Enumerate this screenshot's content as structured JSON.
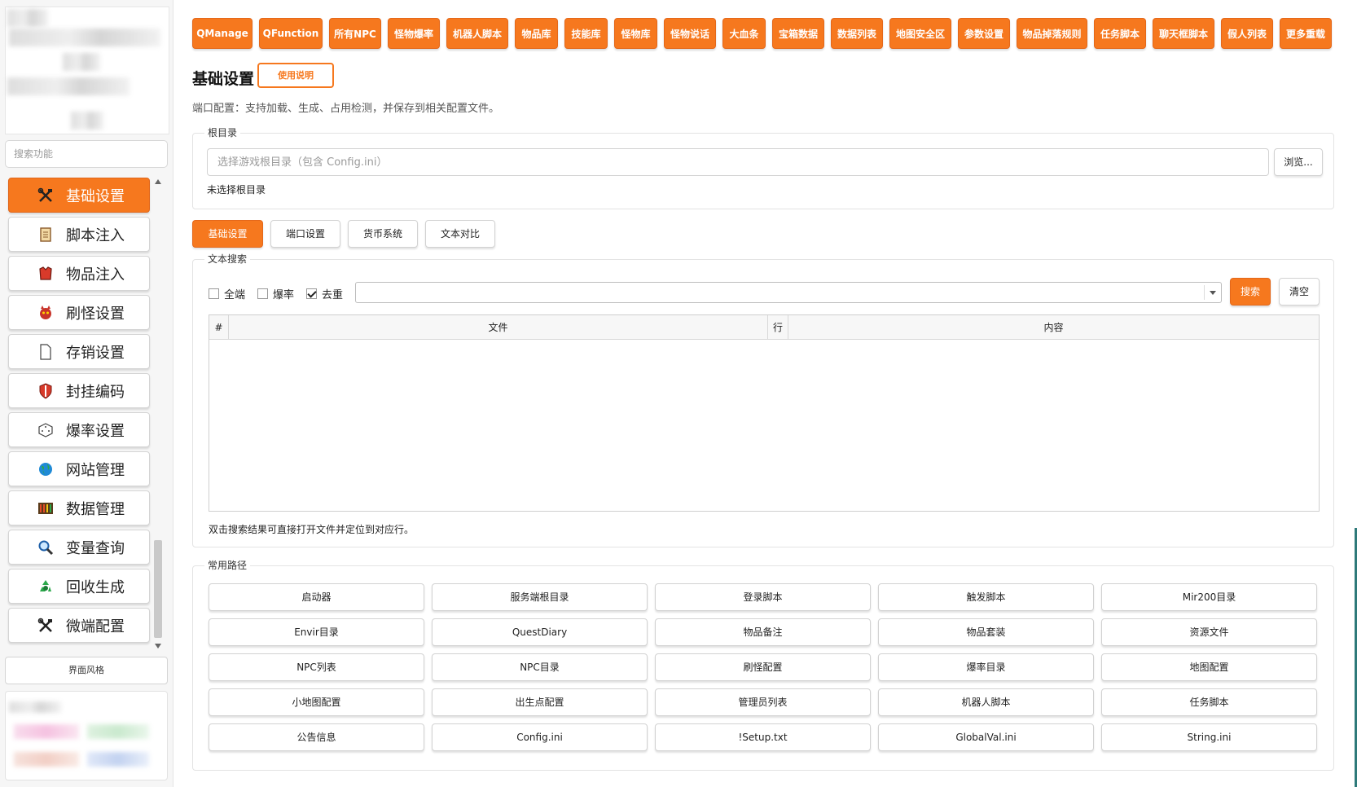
{
  "sidebar": {
    "search_placeholder": "搜索功能",
    "items": [
      {
        "label": "基础设置",
        "icon": "tools-icon",
        "active": true
      },
      {
        "label": "脚本注入",
        "icon": "scroll-icon"
      },
      {
        "label": "物品注入",
        "icon": "armor-icon"
      },
      {
        "label": "刷怪设置",
        "icon": "monster-icon"
      },
      {
        "label": "存销设置",
        "icon": "document-icon"
      },
      {
        "label": "封挂编码",
        "icon": "shield-icon"
      },
      {
        "label": "爆率设置",
        "icon": "dice-icon"
      },
      {
        "label": "网站管理",
        "icon": "globe-icon"
      },
      {
        "label": "数据管理",
        "icon": "abacus-icon"
      },
      {
        "label": "变量查询",
        "icon": "magnifier-icon"
      },
      {
        "label": "回收生成",
        "icon": "recycle-icon"
      },
      {
        "label": "微端配置",
        "icon": "tools-icon"
      }
    ],
    "theme_button": "界面风格"
  },
  "toolbar": {
    "buttons": [
      "QManage",
      "QFunction",
      "所有NPC",
      "怪物爆率",
      "机器人脚本",
      "物品库",
      "技能库",
      "怪物库",
      "怪物说话",
      "大血条",
      "宝箱数据",
      "数据列表",
      "地图安全区",
      "参数设置",
      "物品掉落规则",
      "任务脚本",
      "聊天框脚本",
      "假人列表",
      "更多重载"
    ]
  },
  "header": {
    "title": "基础设置",
    "help_button": "使用说明",
    "description": "端口配置：支持加载、生成、占用检测，并保存到相关配置文件。"
  },
  "root_dir": {
    "legend": "根目录",
    "placeholder": "选择游戏根目录（包含 Config.ini）",
    "browse_button": "浏览...",
    "status": "未选择根目录"
  },
  "tabs": [
    {
      "label": "基础设置",
      "active": true
    },
    {
      "label": "端口设置"
    },
    {
      "label": "货币系统"
    },
    {
      "label": "文本对比"
    }
  ],
  "text_search": {
    "legend": "文本搜索",
    "checkboxes": [
      {
        "label": "全端",
        "checked": false
      },
      {
        "label": "爆率",
        "checked": false
      },
      {
        "label": "去重",
        "checked": true
      }
    ],
    "query": "",
    "search_button": "搜索",
    "clear_button": "清空",
    "columns": [
      "#",
      "文件",
      "行",
      "内容"
    ],
    "rows": [],
    "hint": "双击搜索结果可直接打开文件并定位到对应行。"
  },
  "common_paths": {
    "legend": "常用路径",
    "buttons": [
      "启动器",
      "服务端根目录",
      "登录脚本",
      "触发脚本",
      "Mir200目录",
      "Envir目录",
      "QuestDiary",
      "物品备注",
      "物品套装",
      "资源文件",
      "NPC列表",
      "NPC目录",
      "刷怪配置",
      "爆率目录",
      "地图配置",
      "小地图配置",
      "出生点配置",
      "管理员列表",
      "机器人脚本",
      "任务脚本",
      "公告信息",
      "Config.ini",
      "!Setup.txt",
      "GlobalVal.ini",
      "String.ini"
    ]
  },
  "colors": {
    "accent": "#f6781e",
    "border": "#d2d2d2"
  }
}
